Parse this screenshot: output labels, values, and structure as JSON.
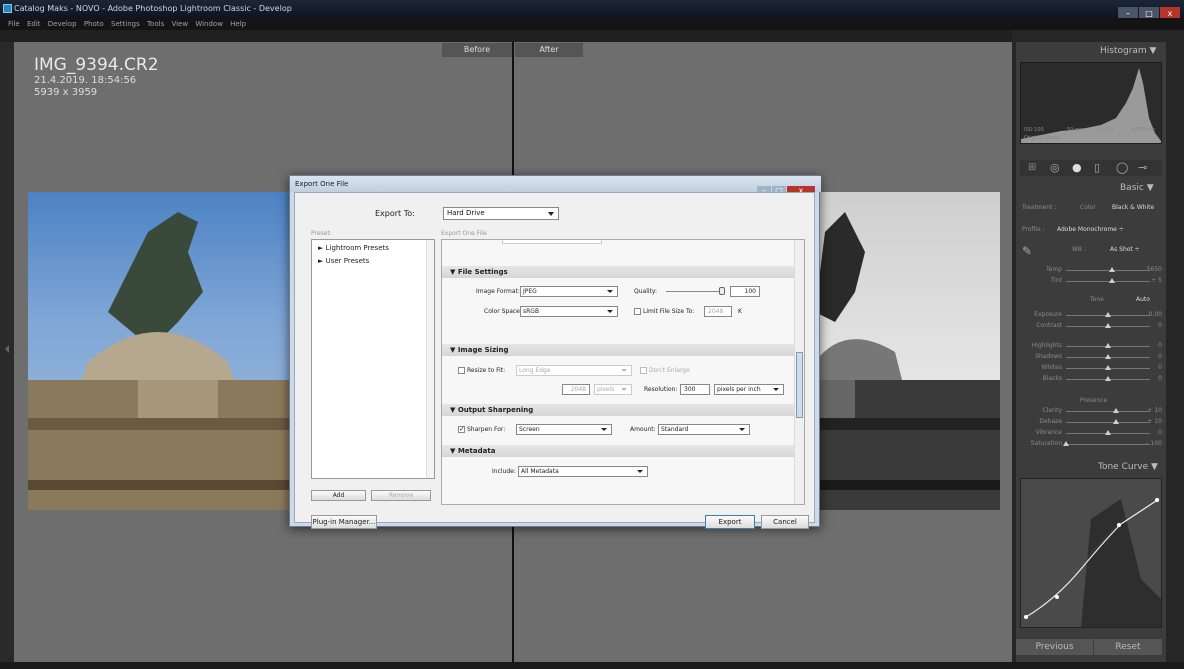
{
  "window": {
    "title": "Catalog Maks - NOVO - Adobe Photoshop Lightroom Classic - Develop",
    "controls": {
      "minimize": "–",
      "maximize": "□",
      "close": "x"
    }
  },
  "menu": [
    "File",
    "Edit",
    "Develop",
    "Photo",
    "Settings",
    "Tools",
    "View",
    "Window",
    "Help"
  ],
  "viewer": {
    "before_label": "Before",
    "after_label": "After",
    "filename": "IMG_9394.CR2",
    "datetime": "21.4.2019. 18:54:56",
    "dimensions": "5939 x 3959"
  },
  "right_panel": {
    "histogram_title": "Histogram ▼",
    "histogram_meta": {
      "iso": "ISO 100",
      "focal": "50 mm",
      "aperture": "ƒ / 2,8",
      "shutter": "1/500 sec",
      "original": "Original Photo"
    },
    "basic_title": "Basic ▼",
    "treatment": {
      "label": "Treatment :",
      "color": "Color",
      "bw": "Black & White"
    },
    "profile": {
      "label": "Profile :",
      "value": "Adobe Monochrome ÷"
    },
    "wb": {
      "label": "WB :",
      "value": "As Shot ÷"
    },
    "sliders_wb": [
      {
        "label": "Temp",
        "value": "5650",
        "pos": 0.55
      },
      {
        "label": "Tint",
        "value": "+ 5",
        "pos": 0.55
      }
    ],
    "tone_label": "Tone",
    "auto_label": "Auto",
    "sliders_tone": [
      {
        "label": "Exposure",
        "value": "0,00",
        "pos": 0.5
      },
      {
        "label": "Contrast",
        "value": "0",
        "pos": 0.5
      }
    ],
    "sliders_hl": [
      {
        "label": "Highlights",
        "value": "0",
        "pos": 0.5
      },
      {
        "label": "Shadows",
        "value": "0",
        "pos": 0.5
      },
      {
        "label": "Whites",
        "value": "0",
        "pos": 0.5
      },
      {
        "label": "Blacks",
        "value": "0",
        "pos": 0.5
      }
    ],
    "presence_label": "Presence",
    "sliders_presence": [
      {
        "label": "Clarity",
        "value": "+ 10",
        "pos": 0.6
      },
      {
        "label": "Dehaze",
        "value": "+ 10",
        "pos": 0.6
      },
      {
        "label": "Vibrance",
        "value": "0",
        "pos": 0.5
      },
      {
        "label": "Saturation",
        "value": "– 100",
        "pos": 0.0
      }
    ],
    "tone_curve_title": "Tone Curve ▼",
    "previous_label": "Previous",
    "reset_label": "Reset"
  },
  "dialog": {
    "title": "Export One File",
    "export_to_label": "Export To:",
    "export_to_value": "Hard Drive",
    "preset_label": "Preset:",
    "export_one_file_label": "Export One File",
    "presets": [
      "Lightroom Presets",
      "User Presets"
    ],
    "add_label": "Add",
    "remove_label": "Remove",
    "plugin_manager_label": "Plug-in Manager...",
    "export_label": "Export",
    "cancel_label": "Cancel",
    "file_settings": {
      "title": "File Settings",
      "image_format_label": "Image Format:",
      "image_format_value": "JPEG",
      "quality_label": "Quality:",
      "quality_value": "100",
      "quality_pos": 1.0,
      "color_space_label": "Color Space:",
      "color_space_value": "sRGB",
      "limit_label": "Limit File Size To:",
      "limit_value": "2048",
      "limit_unit": "K"
    },
    "image_sizing": {
      "title": "Image Sizing",
      "resize_label": "Resize to Fit:",
      "resize_value": "Long Edge",
      "dont_enlarge_label": "Don't Enlarge",
      "size_value": "2048",
      "size_unit": "pixels",
      "resolution_label": "Resolution:",
      "resolution_value": "300",
      "resolution_unit": "pixels per inch"
    },
    "output_sharpening": {
      "title": "Output Sharpening",
      "sharpen_label": "Sharpen For:",
      "sharpen_value": "Screen",
      "amount_label": "Amount:",
      "amount_value": "Standard"
    },
    "metadata": {
      "title": "Metadata",
      "include_label": "Include:",
      "include_value": "All Metadata"
    }
  }
}
